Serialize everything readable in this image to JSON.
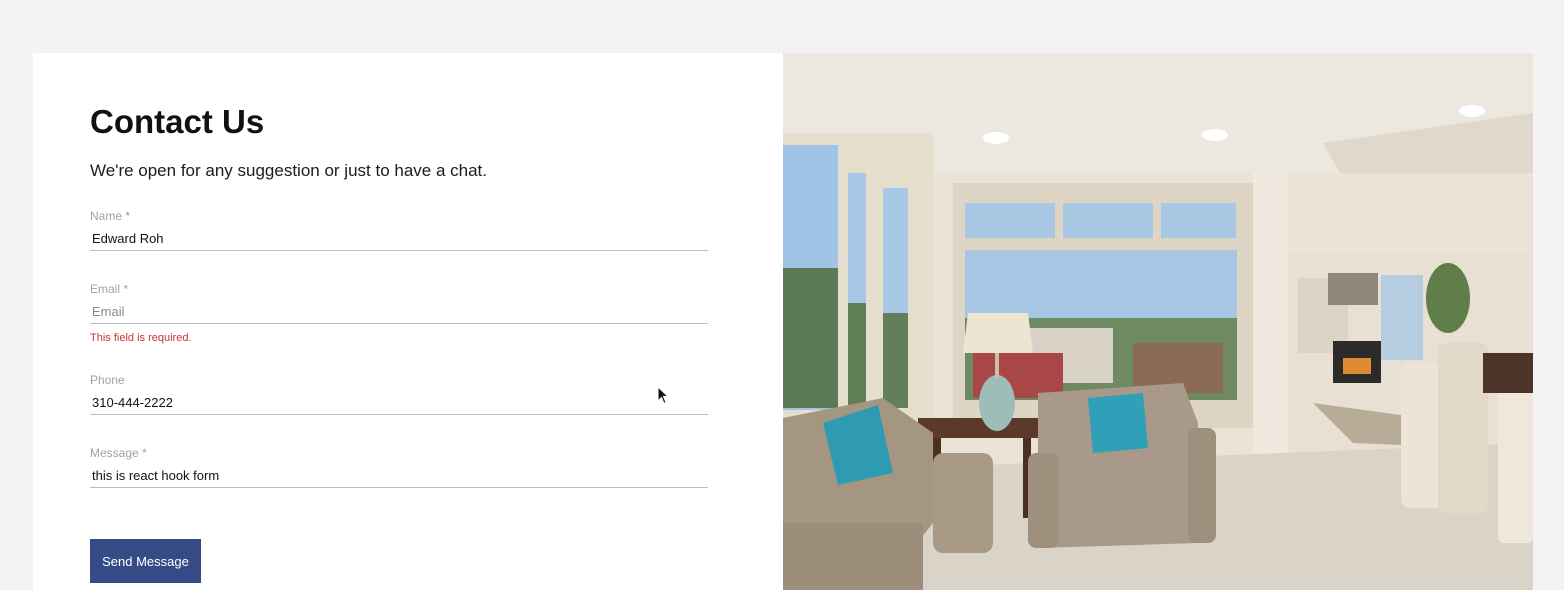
{
  "contact": {
    "title": "Contact Us",
    "subtitle": "We're open for any suggestion or just to have a chat."
  },
  "form": {
    "name": {
      "label": "Name *",
      "value": "Edward Roh"
    },
    "email": {
      "label": "Email *",
      "value": "",
      "placeholder": "Email",
      "error": "This field is required."
    },
    "phone": {
      "label": "Phone",
      "value": "310-444-2222"
    },
    "message": {
      "label": "Message *",
      "value": "this is react hook form"
    },
    "submit_label": "Send Message"
  },
  "colors": {
    "button": "#344b85",
    "error": "#c0392b",
    "page_background": "#f3f3f3"
  },
  "photo": {
    "subject": "living-room-photo"
  }
}
